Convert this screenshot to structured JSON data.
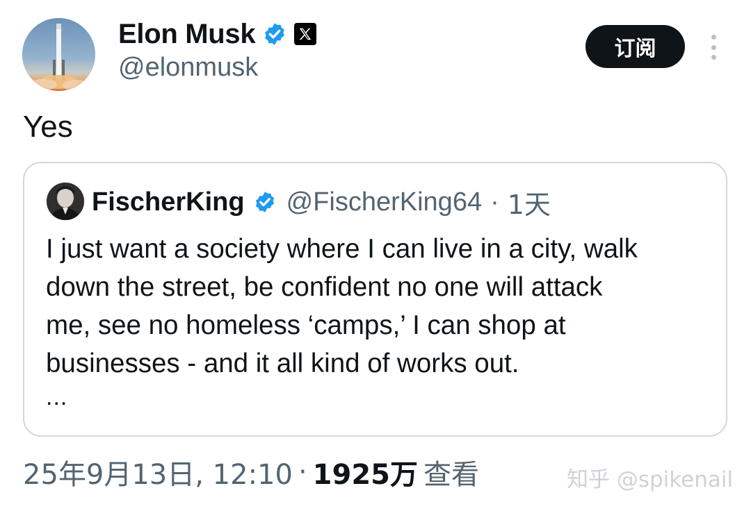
{
  "author": {
    "display_name": "Elon Musk",
    "handle": "@elonmusk",
    "avatar_icon": "rocket-launch-avatar",
    "verified_color": "#1d9bf0"
  },
  "header": {
    "subscribe_label": "订阅",
    "more_icon": "more-vertical-icon"
  },
  "tweet": {
    "text": "Yes"
  },
  "quote": {
    "display_name": "FischerKing",
    "handle": "@FischerKing64",
    "separator": "·",
    "time": "1天",
    "lines": [
      "I just want a society where I can live in a city, walk",
      "down the street, be confident no one will attack",
      "me, see no homeless ‘camps,’ I can shop at",
      "businesses - and it all kind of works out."
    ],
    "ellipsis": "..."
  },
  "meta": {
    "timestamp": "25年9月13日, 12:10",
    "separator": "·",
    "views_count": "1925万",
    "views_label": "查看"
  },
  "watermark": "知乎 @spikenail"
}
